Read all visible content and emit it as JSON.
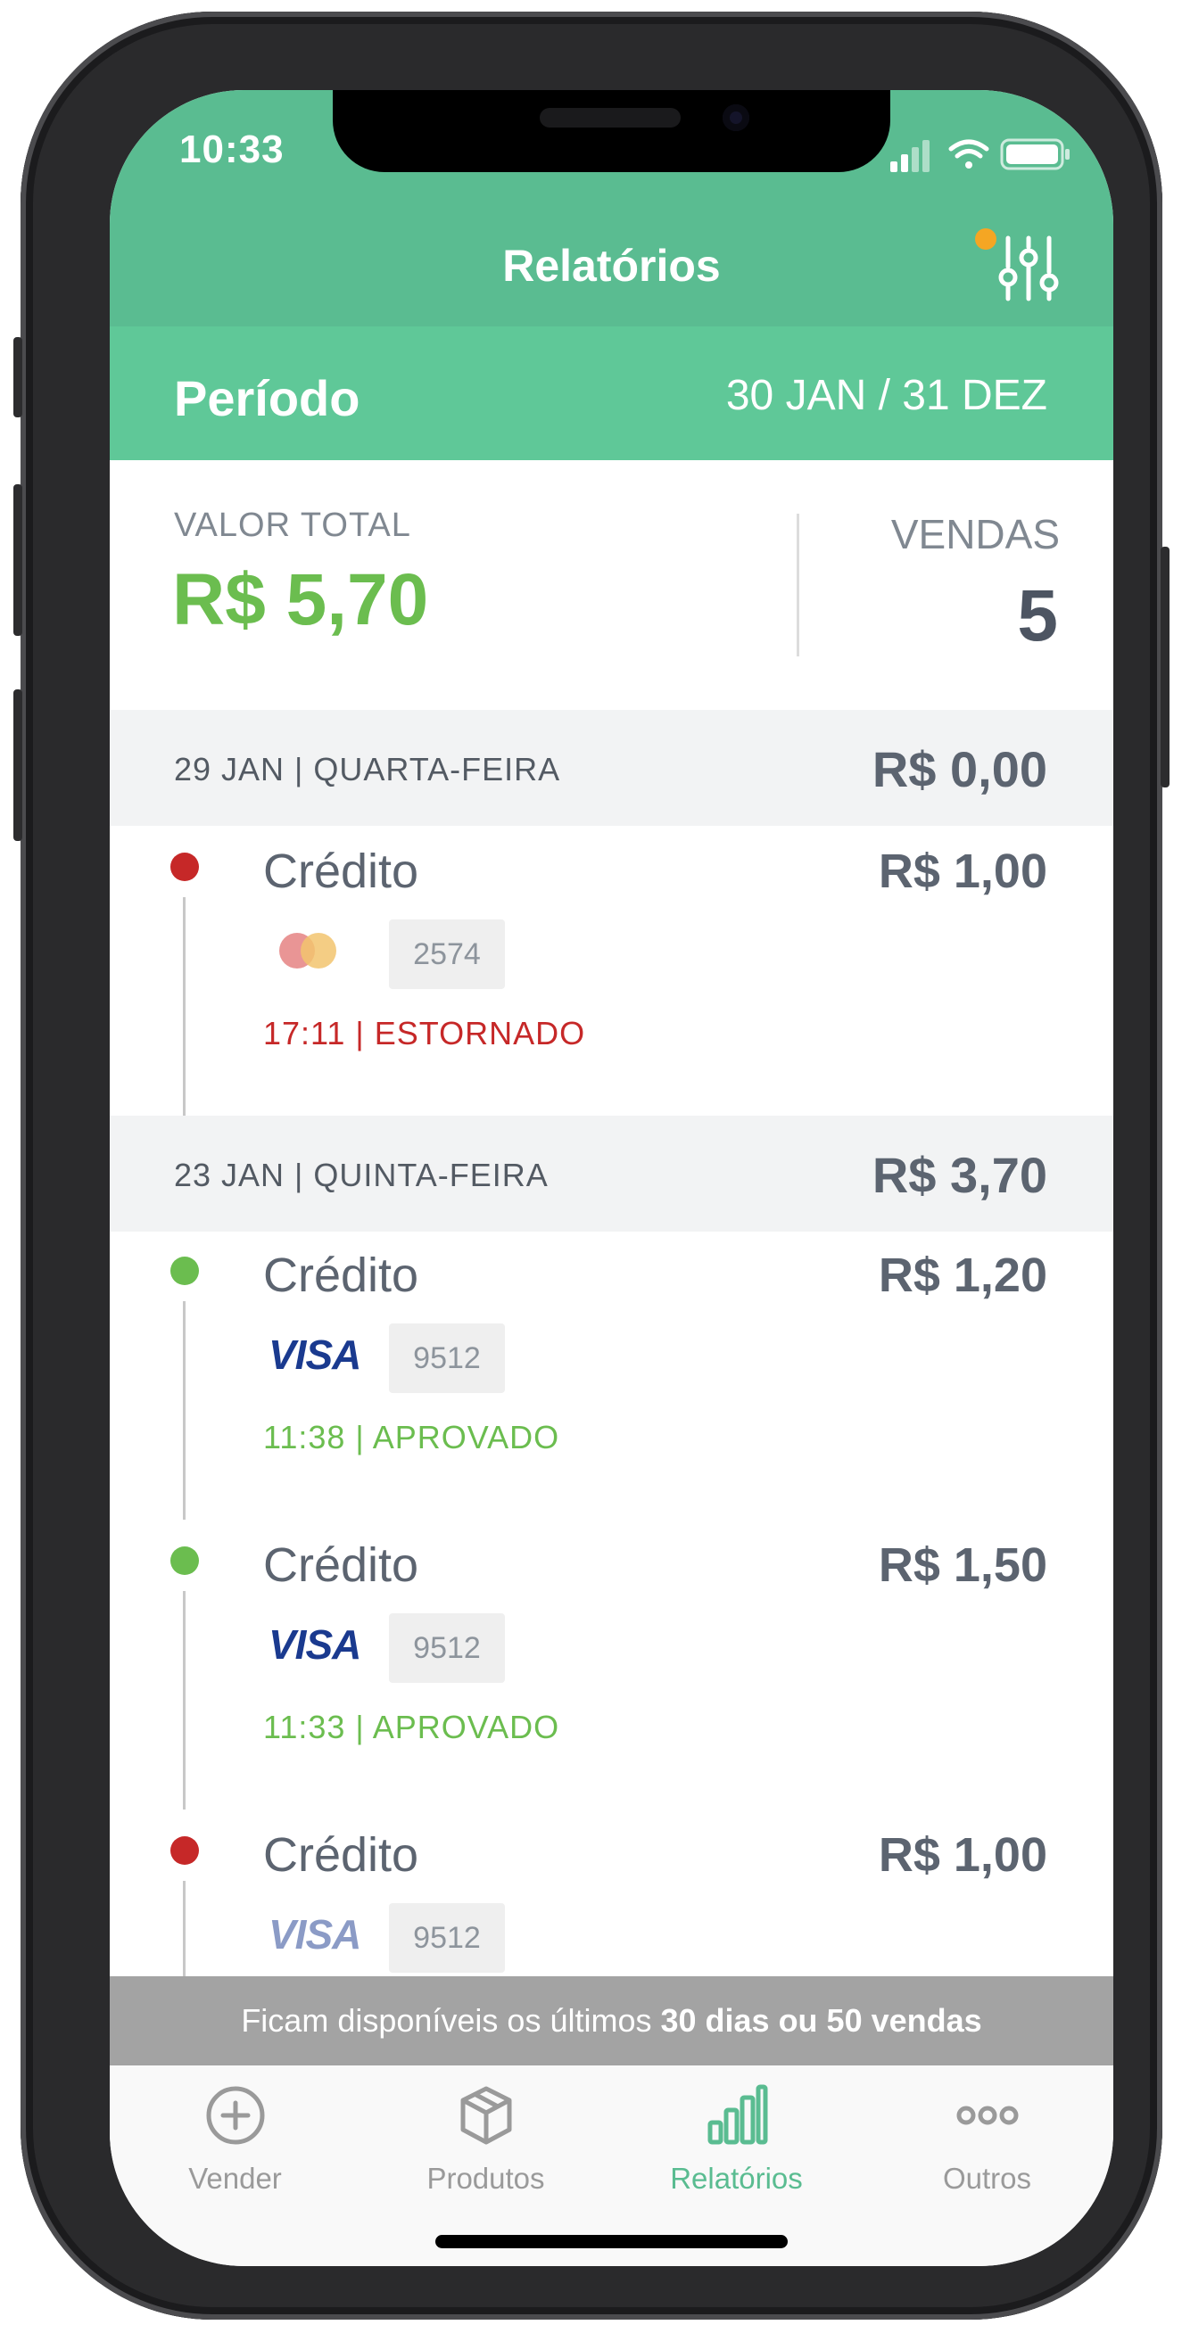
{
  "status_bar": {
    "time": "10:33"
  },
  "nav": {
    "title": "Relatórios",
    "filter_icon": "sliders-icon",
    "filter_badge_color": "#f5a623"
  },
  "period": {
    "label": "Período",
    "range": "30 JAN / 31 DEZ"
  },
  "summary": {
    "total_label": "VALOR TOTAL",
    "total_value": "R$ 5,70",
    "sales_label": "VENDAS",
    "sales_value": "5"
  },
  "days": [
    {
      "title": "29 JAN | QUARTA-FEIRA",
      "total": "R$ 0,00",
      "transactions": [
        {
          "method": "Crédito",
          "amount": "R$ 1,00",
          "brand": "mastercard",
          "last_digits": "2574",
          "status": "17:11 | ESTORNADO",
          "status_color": "#c62828"
        }
      ]
    },
    {
      "title": "23 JAN | QUINTA-FEIRA",
      "total": "R$ 3,70",
      "transactions": [
        {
          "method": "Crédito",
          "amount": "R$ 1,20",
          "brand": "VISA",
          "last_digits": "9512",
          "status": "11:38 | APROVADO",
          "status_color": "#6bbd4f"
        },
        {
          "method": "Crédito",
          "amount": "R$ 1,50",
          "brand": "VISA",
          "last_digits": "9512",
          "status": "11:33 | APROVADO",
          "status_color": "#6bbd4f"
        },
        {
          "method": "Crédito",
          "amount": "R$ 1,00",
          "brand": "VISA",
          "last_digits": "9512",
          "status": "",
          "status_color": "#c62828"
        }
      ]
    }
  ],
  "notice": {
    "prefix": "Ficam disponíveis os últimos ",
    "bold": "30 dias ou 50 vendas"
  },
  "tabs": [
    {
      "label": "Vender",
      "icon": "plus-circle-icon"
    },
    {
      "label": "Produtos",
      "icon": "box-icon"
    },
    {
      "label": "Relatórios",
      "icon": "bar-chart-icon",
      "active": true
    },
    {
      "label": "Outros",
      "icon": "more-icon"
    }
  ],
  "colors": {
    "brand_green": "#5abc91",
    "approved": "#6bbd4f",
    "refunded": "#c62828"
  }
}
